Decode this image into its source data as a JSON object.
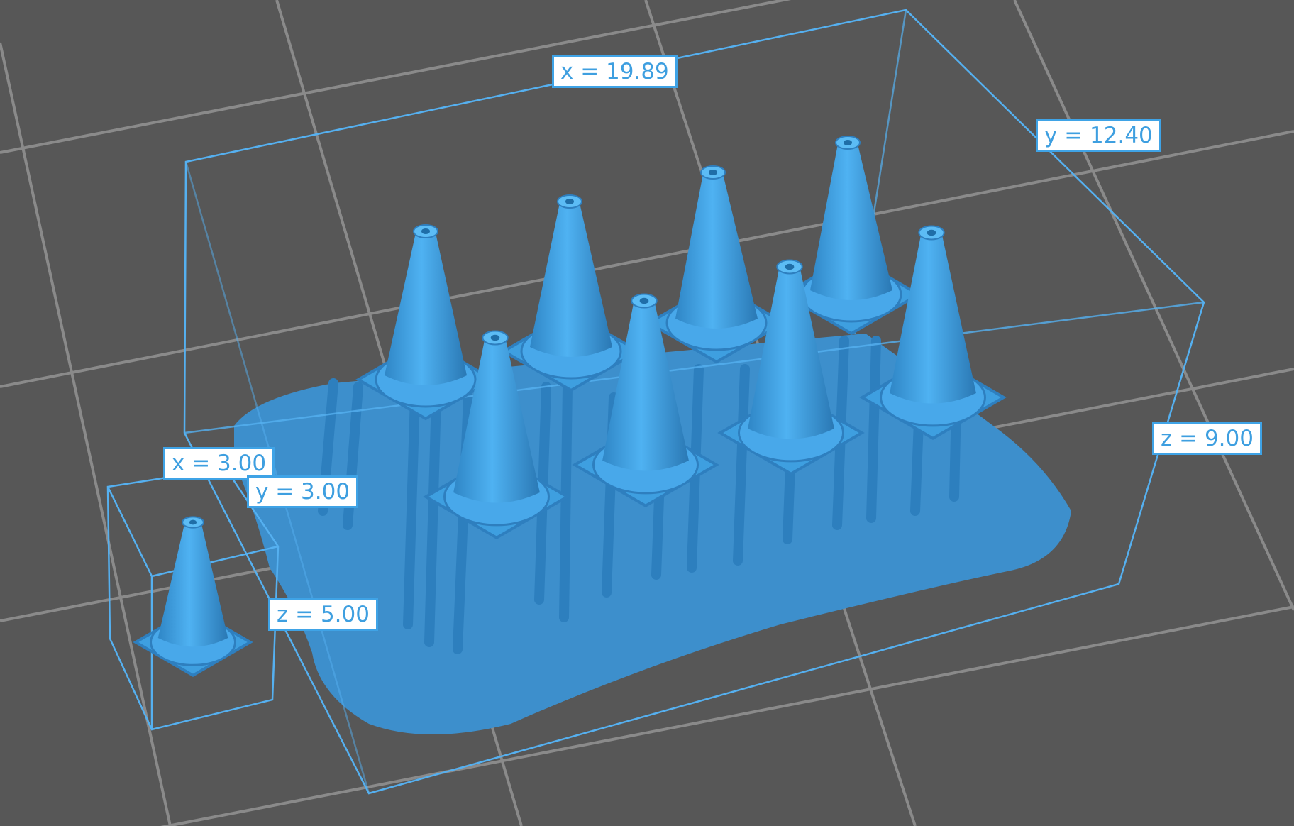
{
  "viewport": {
    "background": "#575757",
    "grid_color": "#8a8a8a",
    "model_color": "#3e9fe0",
    "model_shadow": "#2e7fbf",
    "raft_color": "#3d8fcc",
    "bbox_color": "#55b0f0"
  },
  "scene": {
    "array_cone_count": 8,
    "array_layout": "4 x 2",
    "single_cone_count": 1
  },
  "labels": {
    "array": {
      "x": "x = 19.89",
      "y": "y = 12.40",
      "z": "z = 9.00"
    },
    "single": {
      "x": "x = 3.00",
      "y": "y = 3.00",
      "z": "z = 5.00"
    }
  }
}
